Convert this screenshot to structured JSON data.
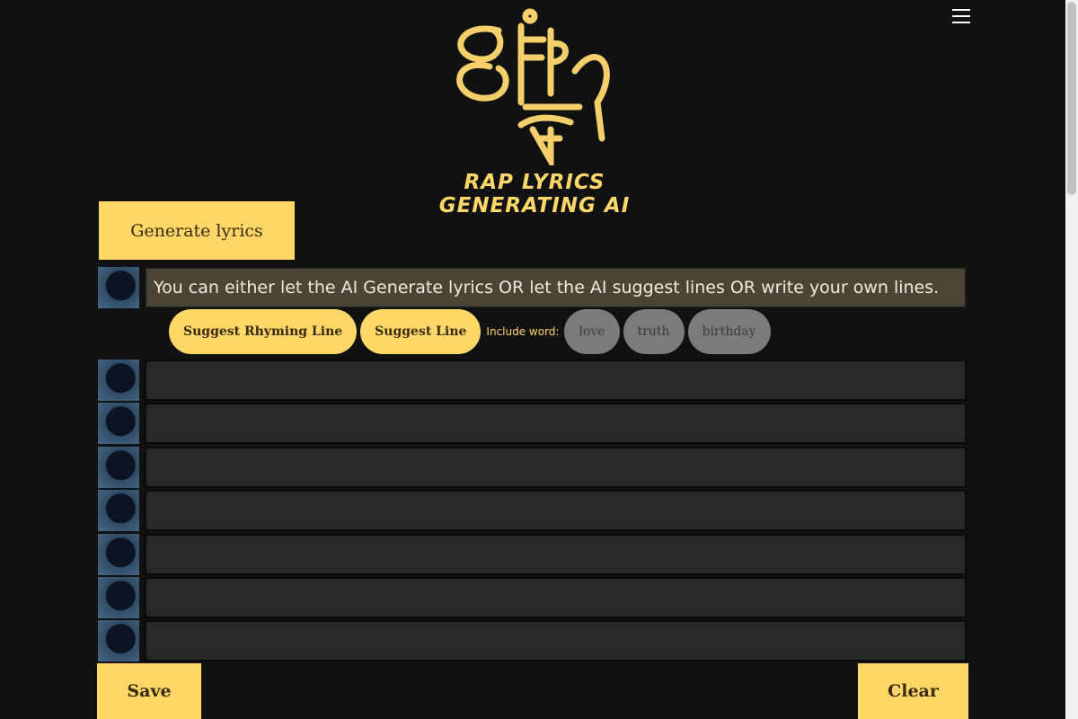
{
  "header": {
    "logo_text": "DEEP BEAT",
    "subtitle": "RAP LYRICS GENERATING AI",
    "menu_icon": "hamburger-icon"
  },
  "generate_label": "Generate lyrics",
  "lines": [
    "You can either let the AI Generate lyrics OR let the AI suggest lines OR write your own lines.",
    "",
    "",
    "",
    "",
    "",
    "",
    ""
  ],
  "suggest": {
    "rhyming_label": "Suggest Rhyming Line",
    "line_label": "Suggest Line",
    "include_label": "Include word:",
    "words": [
      "love",
      "truth",
      "birthday"
    ]
  },
  "footer": {
    "save_label": "Save",
    "clear_label": "Clear"
  },
  "colors": {
    "accent": "#ffd867",
    "background": "#111111",
    "line_bg": "#282828",
    "first_line_bg": "#4a4534"
  }
}
